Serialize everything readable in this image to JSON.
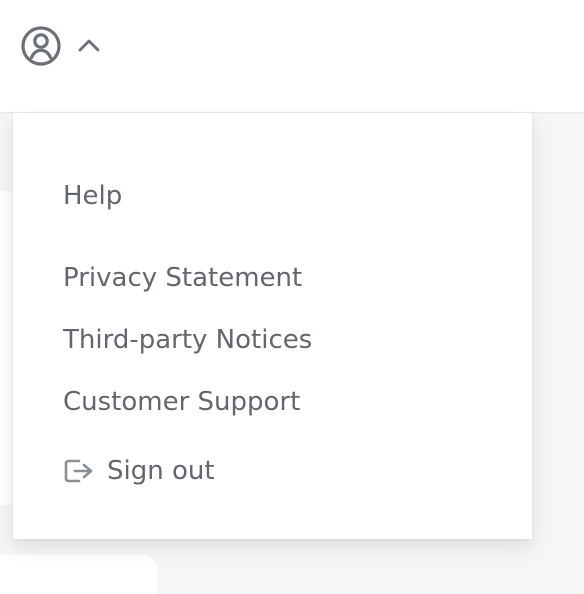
{
  "header": {
    "account_icon": "user-circle-icon",
    "toggle_icon": "chevron-up-icon"
  },
  "menu": {
    "items": [
      {
        "label": "Help"
      },
      {
        "label": "Privacy Statement"
      },
      {
        "label": "Third-party Notices"
      },
      {
        "label": "Customer Support"
      }
    ],
    "sign_out": {
      "icon": "sign-out-icon",
      "label": "Sign out"
    }
  },
  "colors": {
    "page_background": "#f6f6f8",
    "surface": "#ffffff",
    "text": "#62666d",
    "icon": "#6b6f76"
  }
}
